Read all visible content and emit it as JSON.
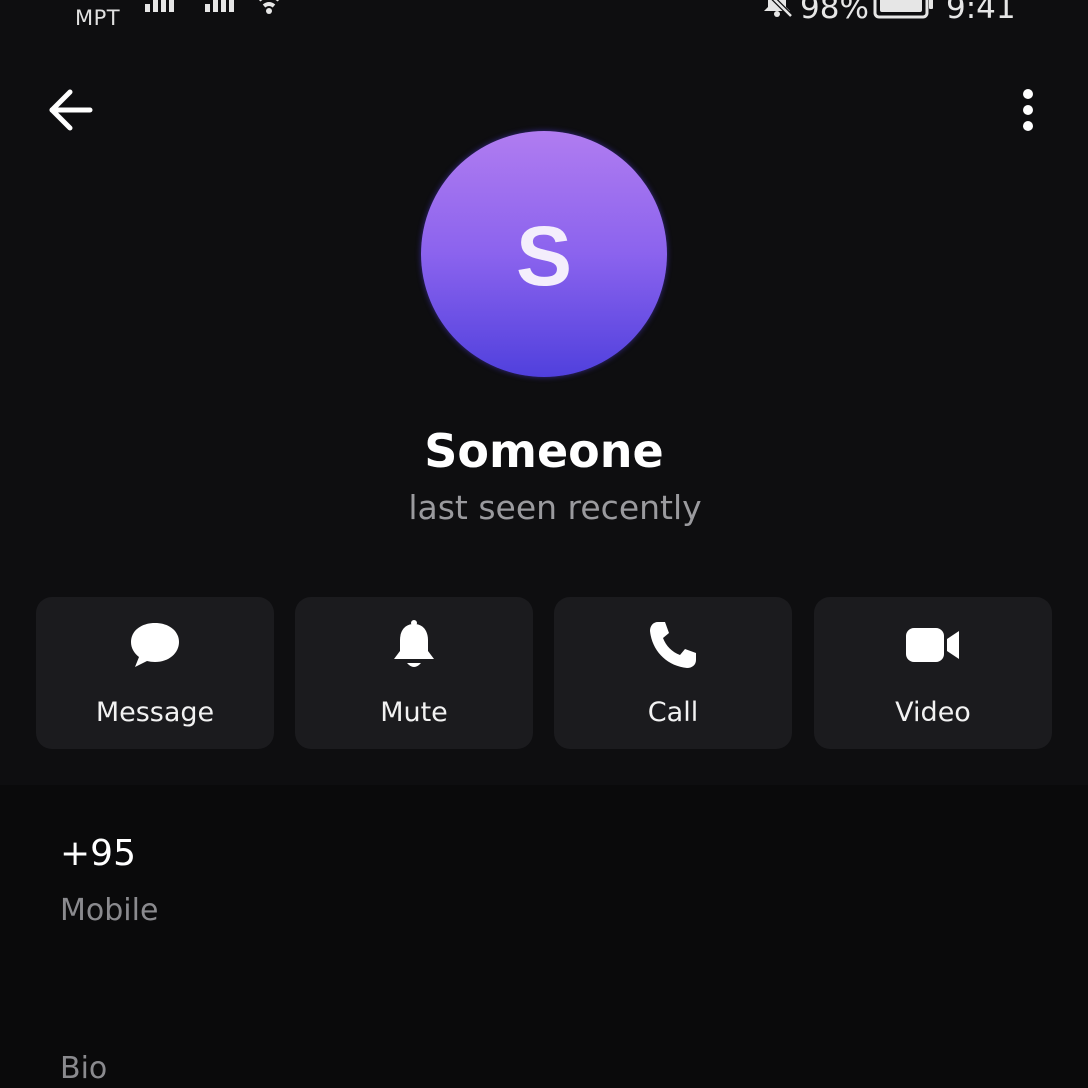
{
  "status_bar": {
    "carrier": "MPT",
    "battery_percent": "98%",
    "time": "9:41",
    "icons": [
      "signal-icon",
      "signal-icon",
      "wifi-icon",
      "bell-off-icon",
      "battery-icon"
    ]
  },
  "top_bar": {
    "back_icon": "arrow-left-icon",
    "more_icon": "more-vertical-icon"
  },
  "profile": {
    "avatar_letter": "S",
    "name": "Someone",
    "status": "last seen recently",
    "avatar_colors": [
      "#b07cf0",
      "#8b63ee",
      "#5040dd"
    ]
  },
  "actions": [
    {
      "label": "Message",
      "icon": "chat-bubble-icon"
    },
    {
      "label": "Mute",
      "icon": "bell-icon"
    },
    {
      "label": "Call",
      "icon": "phone-icon"
    },
    {
      "label": "Video",
      "icon": "video-camera-icon"
    }
  ],
  "info": {
    "phone": "+95",
    "phone_label": "Mobile",
    "bio_label": "Bio"
  },
  "colors": {
    "background": "#0e0e10",
    "card": "#1b1b1e",
    "secondary_text": "#9a9a9e"
  }
}
